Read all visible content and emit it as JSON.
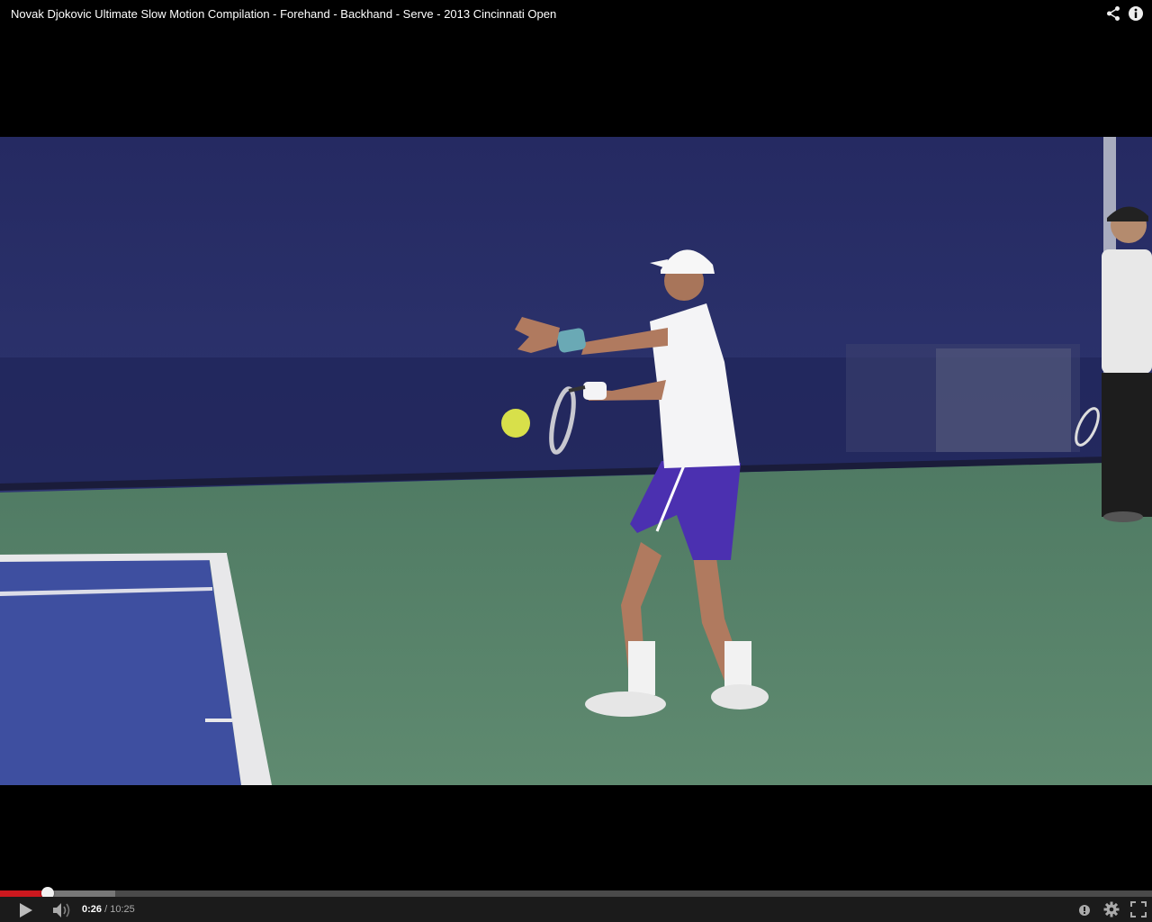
{
  "title_bar": {
    "title": "Novak Djokovic Ultimate Slow Motion Compilation - Forehand - Backhand - Serve - 2013 Cincinnati Open",
    "share_icon": "share-icon",
    "info_icon": "info-icon"
  },
  "video": {
    "scene": "tennis-player-forehand-frame"
  },
  "controls": {
    "current_time": "0:26",
    "separator": " / ",
    "duration": "10:25",
    "progress_fraction": 0.0416,
    "buffered_fraction": 0.1,
    "play_icon": "play-icon",
    "volume_icon": "volume-icon",
    "annotations_icon": "annotations-icon",
    "settings_icon": "settings-icon",
    "fullscreen_icon": "fullscreen-icon"
  },
  "colors": {
    "played": "#cc181e",
    "background": "#000000",
    "control_bar": "#1b1b1b"
  }
}
